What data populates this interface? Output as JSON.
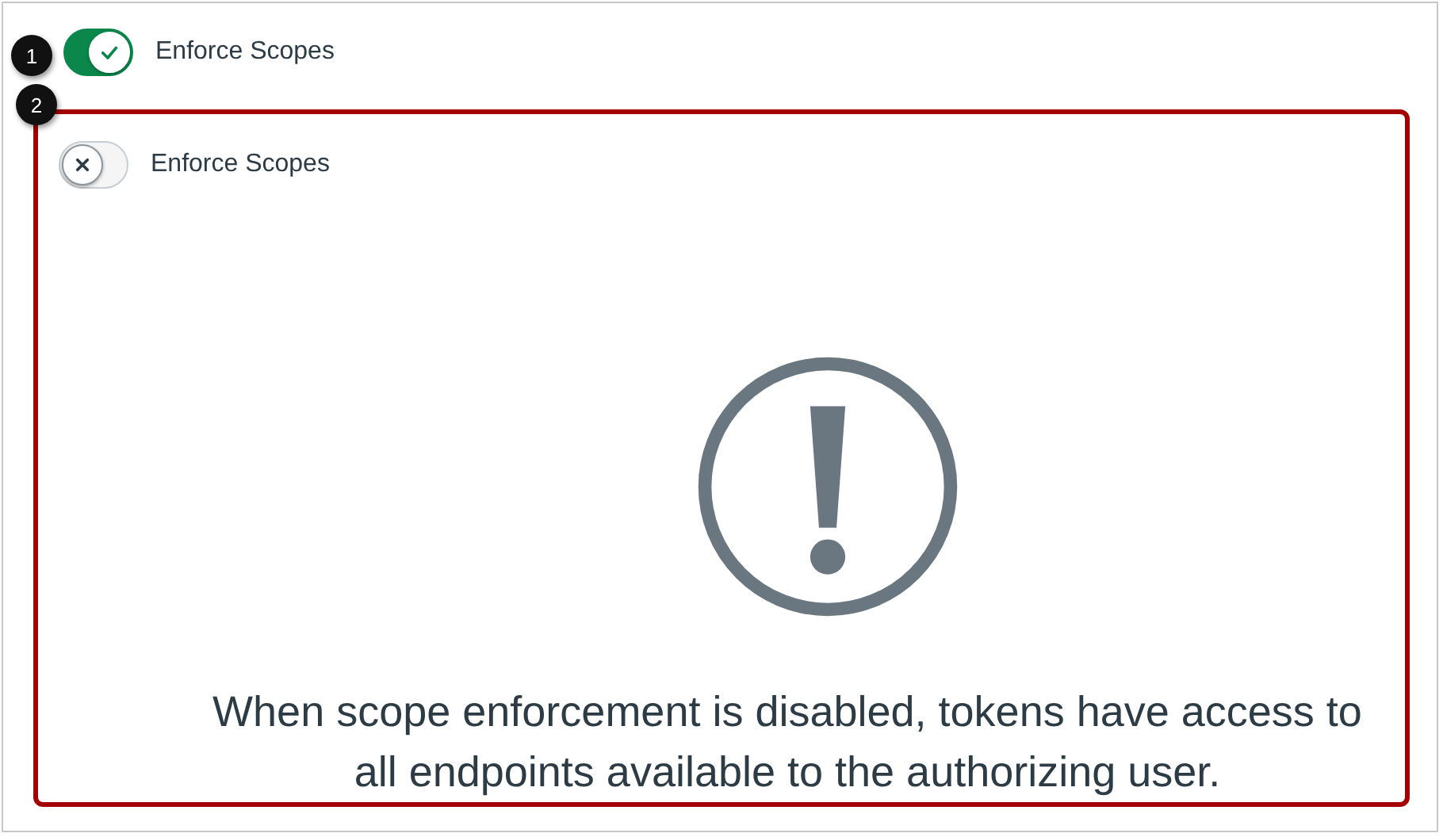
{
  "toggle": {
    "label": "Enforce Scopes",
    "on": true,
    "callout": "1"
  },
  "disabled_example": {
    "callout": "2",
    "toggle": {
      "label": "Enforce Scopes",
      "on": false
    },
    "warning": "When scope enforcement is disabled, tokens have access to all endpoints available to the authorizing user."
  }
}
